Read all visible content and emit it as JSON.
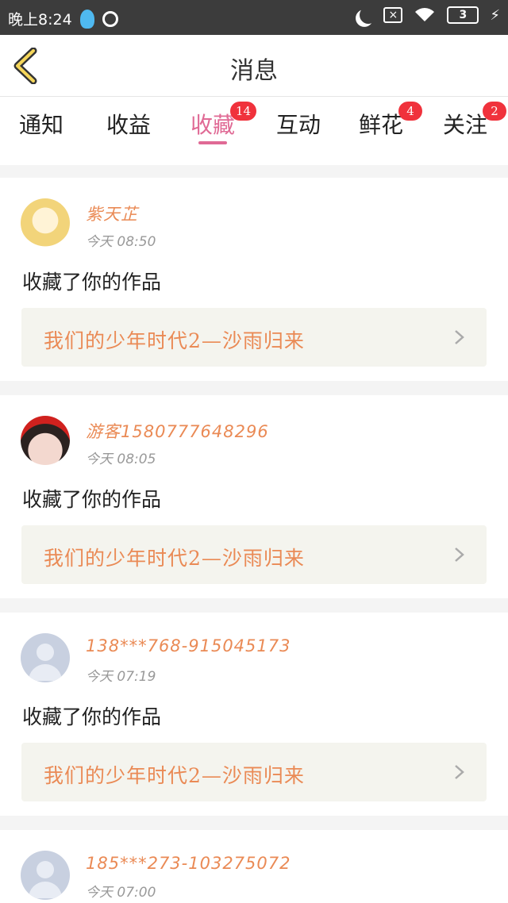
{
  "status_bar": {
    "time": "晚上8:24",
    "battery": "3"
  },
  "header": {
    "title": "消息"
  },
  "tabs": [
    {
      "label": "通知",
      "badge": ""
    },
    {
      "label": "收益",
      "badge": ""
    },
    {
      "label": "收藏",
      "badge": "14",
      "active": true
    },
    {
      "label": "互动",
      "badge": ""
    },
    {
      "label": "鲜花",
      "badge": "4"
    },
    {
      "label": "关注",
      "badge": "2"
    }
  ],
  "messages": [
    {
      "user": "紫天芷",
      "time": "今天 08:50",
      "action": "收藏了你的作品",
      "work": "我们的少年时代2—沙雨归来"
    },
    {
      "user": "游客15807776482​96",
      "time": "今天 08:05",
      "action": "收藏了你的作品",
      "work": "我们的少年时代2—沙雨归来"
    },
    {
      "user": "138***768-915045173",
      "time": "今天 07:19",
      "action": "收藏了你的作品",
      "work": "我们的少年时代2—沙雨归来"
    },
    {
      "user": "185***273-103275072",
      "time": "今天 07:00",
      "action": "",
      "work": ""
    }
  ],
  "colors": {
    "accent": "#e06a95",
    "name": "#ea8a55",
    "badge": "#f0323c"
  }
}
